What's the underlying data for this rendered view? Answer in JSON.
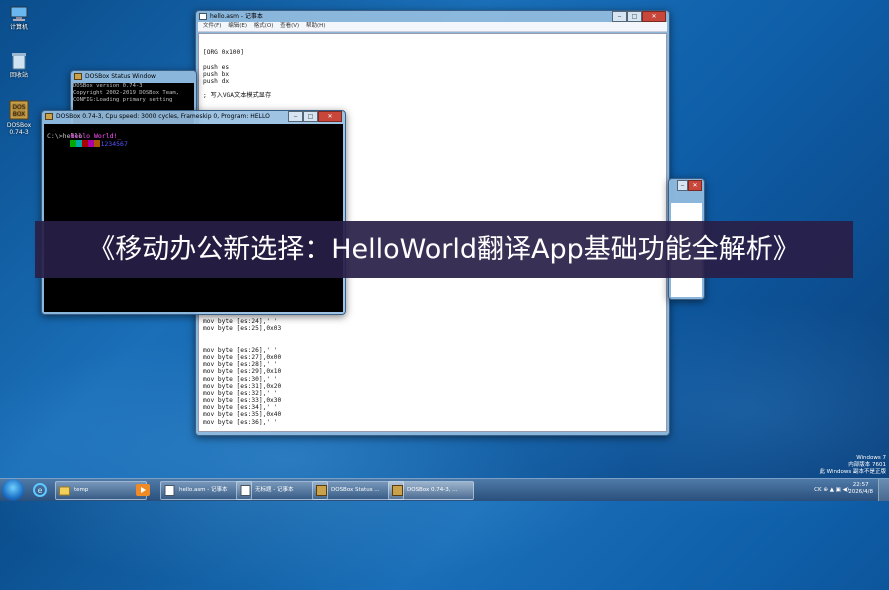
{
  "desktop": {
    "icons": [
      {
        "label": "计算机"
      },
      {
        "label": "回收站"
      },
      {
        "label": "DOSBox 0.74-3"
      }
    ]
  },
  "notepad": {
    "title": "hello.asm - 记事本",
    "menu": [
      "文件(F)",
      "编辑(E)",
      "格式(O)",
      "查看(V)",
      "帮助(H)"
    ],
    "lines_top": [
      "",
      "[ORG 0x100]",
      "",
      "push es",
      "push bx",
      "push dx",
      "",
      "; 写入VGA文本模式显存"
    ],
    "lines_bottom": [
      "mov byte [es:24],' '",
      "mov byte [es:25],0x03",
      "",
      "",
      "mov byte [es:26],' '",
      "mov byte [es:27],0x00",
      "mov byte [es:28],' '",
      "mov byte [es:29],0x10",
      "mov byte [es:30],' '",
      "mov byte [es:31],0x20",
      "mov byte [es:32],' '",
      "mov byte [es:33],0x30",
      "mov byte [es:34],' '",
      "mov byte [es:35],0x40",
      "mov byte [es:36],' '"
    ]
  },
  "status_window": {
    "title": "DOSBox Status Window",
    "lines": [
      "DOSBox version 0.74-3",
      "Copyright 2002-2019 DOSBox Team,",
      "CONFIG:Loading primary setting"
    ]
  },
  "dosbox": {
    "title": "DOSBox 0.74-3, Cpu speed:     3000 cycles, Frameskip  0, Program:   HELLO",
    "hello_text": "Hello World!_",
    "digits": "1234567",
    "prompt": "C:\\>hello"
  },
  "banner": {
    "text": "《移动办公新选择：HelloWorld翻译App基础功能全解析》"
  },
  "taskbar": {
    "tasks": [
      {
        "label": "temp"
      },
      {
        "label": "hello.asm - 记事本"
      },
      {
        "label": "无标题 - 记事本"
      },
      {
        "label": "DOSBox Status ..."
      },
      {
        "label": "DOSBox 0.74-3, ..."
      }
    ],
    "tray_text": "CK  ⊕  ▲  ▣  ◀)",
    "clock_time": "22:57",
    "clock_date": "2026/4/8"
  },
  "watermark": {
    "line1": "Windows 7",
    "line2": "内部版本 7601",
    "line3": "此 Windows 副本不是正版"
  },
  "colors": {
    "banner_bg": "#281e46",
    "dos_screen": "#000000"
  }
}
